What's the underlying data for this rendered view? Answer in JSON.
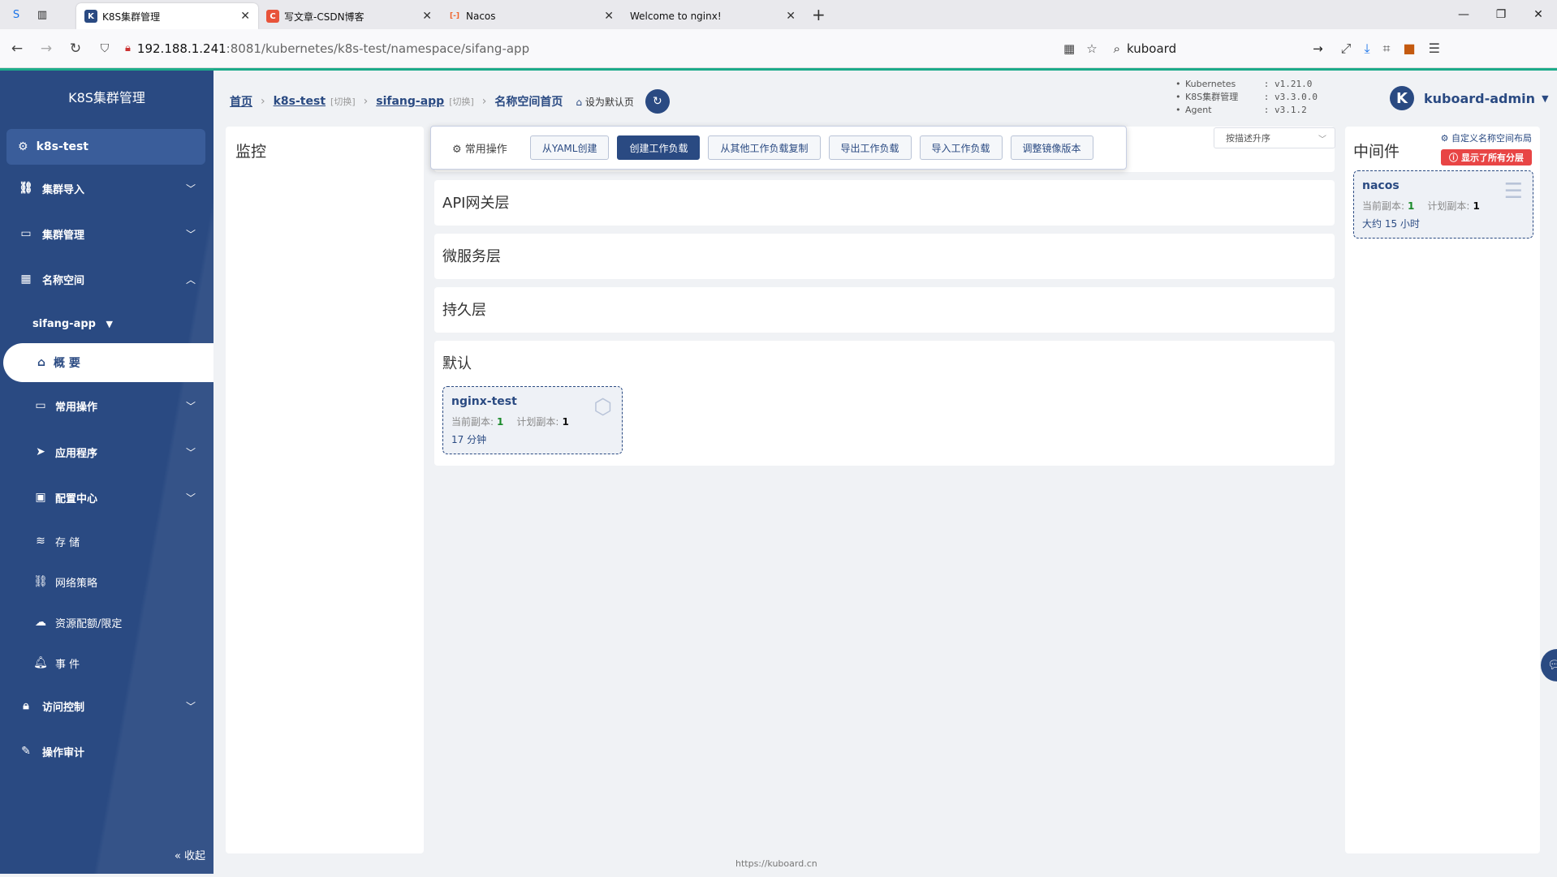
{
  "browser": {
    "tabs": [
      {
        "label": "K8S集群管理",
        "fav": "K",
        "color": "#2a4a82",
        "active": true
      },
      {
        "label": "写文章-CSDN博客",
        "fav": "C",
        "color": "#e8533a",
        "active": false
      },
      {
        "label": "Nacos",
        "fav": "[-]",
        "color": "#f0642c",
        "active": false
      },
      {
        "label": "Welcome to nginx!",
        "fav": "",
        "color": "",
        "active": false
      }
    ],
    "url_host": "192.188.1.241",
    "url_path": ":8081/kubernetes/k8s-test/namespace/sifang-app",
    "search": "kuboard"
  },
  "sidebar": {
    "title": "K8S集群管理",
    "cluster": "k8s-test",
    "items": {
      "import": "集群导入",
      "manage": "集群管理",
      "namespace": "名称空间",
      "ns_name": "sifang-app",
      "overview": "概 要",
      "common_ops": "常用操作",
      "apps": "应用程序",
      "config": "配置中心",
      "storage": "存 储",
      "netpolicy": "网络策略",
      "quota": "资源配额/限定",
      "events": "事 件",
      "access": "访问控制",
      "audit": "操作审计"
    },
    "collapse": "收起"
  },
  "breadcrumb": {
    "home": "首页",
    "cluster": "k8s-test",
    "switch1": "[切换]",
    "namespace": "sifang-app",
    "switch2": "[切换]",
    "current": "名称空间首页",
    "set_default": "设为默认页"
  },
  "versions": [
    {
      "k": "Kubernetes",
      "v": "v1.21.0"
    },
    {
      "k": "K8S集群管理",
      "v": "v3.3.0.0"
    },
    {
      "k": "Agent",
      "v": "v3.1.2"
    }
  ],
  "user": {
    "avatar": "K",
    "name": "kuboard-admin"
  },
  "monitor": {
    "title": "监控"
  },
  "toolbar": {
    "label": "常用操作",
    "buttons": [
      "从YAML创建",
      "创建工作负载",
      "从其他工作负载复制",
      "导出工作负载",
      "导入工作负载",
      "调整镜像版本"
    ]
  },
  "sort": {
    "value": "按描述升序"
  },
  "sections": {
    "api": "API网关层",
    "micro": "微服务层",
    "persist": "持久层",
    "default": "默认"
  },
  "workload": {
    "name": "nginx-test",
    "current_label": "当前副本:",
    "current": "1",
    "planned_label": "计划副本:",
    "planned": "1",
    "age": "17 分钟"
  },
  "middleware": {
    "title": "中间件",
    "customize": "自定义名称空间布局",
    "show_all": "显示了所有分层",
    "card": {
      "name": "nacos",
      "current_label": "当前副本:",
      "current": "1",
      "planned_label": "计划副本:",
      "planned": "1",
      "age": "大约 15 小时"
    }
  },
  "footer": "https://kuboard.cn"
}
